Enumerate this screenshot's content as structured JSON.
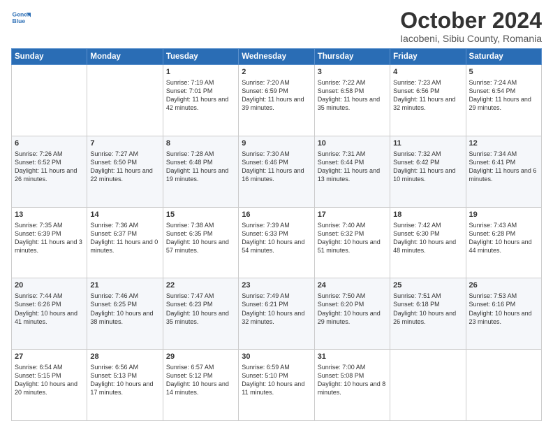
{
  "header": {
    "logo_line1": "General",
    "logo_line2": "Blue",
    "month": "October 2024",
    "location": "Iacobeni, Sibiu County, Romania"
  },
  "weekdays": [
    "Sunday",
    "Monday",
    "Tuesday",
    "Wednesday",
    "Thursday",
    "Friday",
    "Saturday"
  ],
  "weeks": [
    [
      {
        "day": "",
        "info": ""
      },
      {
        "day": "",
        "info": ""
      },
      {
        "day": "1",
        "info": "Sunrise: 7:19 AM\nSunset: 7:01 PM\nDaylight: 11 hours and 42 minutes."
      },
      {
        "day": "2",
        "info": "Sunrise: 7:20 AM\nSunset: 6:59 PM\nDaylight: 11 hours and 39 minutes."
      },
      {
        "day": "3",
        "info": "Sunrise: 7:22 AM\nSunset: 6:58 PM\nDaylight: 11 hours and 35 minutes."
      },
      {
        "day": "4",
        "info": "Sunrise: 7:23 AM\nSunset: 6:56 PM\nDaylight: 11 hours and 32 minutes."
      },
      {
        "day": "5",
        "info": "Sunrise: 7:24 AM\nSunset: 6:54 PM\nDaylight: 11 hours and 29 minutes."
      }
    ],
    [
      {
        "day": "6",
        "info": "Sunrise: 7:26 AM\nSunset: 6:52 PM\nDaylight: 11 hours and 26 minutes."
      },
      {
        "day": "7",
        "info": "Sunrise: 7:27 AM\nSunset: 6:50 PM\nDaylight: 11 hours and 22 minutes."
      },
      {
        "day": "8",
        "info": "Sunrise: 7:28 AM\nSunset: 6:48 PM\nDaylight: 11 hours and 19 minutes."
      },
      {
        "day": "9",
        "info": "Sunrise: 7:30 AM\nSunset: 6:46 PM\nDaylight: 11 hours and 16 minutes."
      },
      {
        "day": "10",
        "info": "Sunrise: 7:31 AM\nSunset: 6:44 PM\nDaylight: 11 hours and 13 minutes."
      },
      {
        "day": "11",
        "info": "Sunrise: 7:32 AM\nSunset: 6:42 PM\nDaylight: 11 hours and 10 minutes."
      },
      {
        "day": "12",
        "info": "Sunrise: 7:34 AM\nSunset: 6:41 PM\nDaylight: 11 hours and 6 minutes."
      }
    ],
    [
      {
        "day": "13",
        "info": "Sunrise: 7:35 AM\nSunset: 6:39 PM\nDaylight: 11 hours and 3 minutes."
      },
      {
        "day": "14",
        "info": "Sunrise: 7:36 AM\nSunset: 6:37 PM\nDaylight: 11 hours and 0 minutes."
      },
      {
        "day": "15",
        "info": "Sunrise: 7:38 AM\nSunset: 6:35 PM\nDaylight: 10 hours and 57 minutes."
      },
      {
        "day": "16",
        "info": "Sunrise: 7:39 AM\nSunset: 6:33 PM\nDaylight: 10 hours and 54 minutes."
      },
      {
        "day": "17",
        "info": "Sunrise: 7:40 AM\nSunset: 6:32 PM\nDaylight: 10 hours and 51 minutes."
      },
      {
        "day": "18",
        "info": "Sunrise: 7:42 AM\nSunset: 6:30 PM\nDaylight: 10 hours and 48 minutes."
      },
      {
        "day": "19",
        "info": "Sunrise: 7:43 AM\nSunset: 6:28 PM\nDaylight: 10 hours and 44 minutes."
      }
    ],
    [
      {
        "day": "20",
        "info": "Sunrise: 7:44 AM\nSunset: 6:26 PM\nDaylight: 10 hours and 41 minutes."
      },
      {
        "day": "21",
        "info": "Sunrise: 7:46 AM\nSunset: 6:25 PM\nDaylight: 10 hours and 38 minutes."
      },
      {
        "day": "22",
        "info": "Sunrise: 7:47 AM\nSunset: 6:23 PM\nDaylight: 10 hours and 35 minutes."
      },
      {
        "day": "23",
        "info": "Sunrise: 7:49 AM\nSunset: 6:21 PM\nDaylight: 10 hours and 32 minutes."
      },
      {
        "day": "24",
        "info": "Sunrise: 7:50 AM\nSunset: 6:20 PM\nDaylight: 10 hours and 29 minutes."
      },
      {
        "day": "25",
        "info": "Sunrise: 7:51 AM\nSunset: 6:18 PM\nDaylight: 10 hours and 26 minutes."
      },
      {
        "day": "26",
        "info": "Sunrise: 7:53 AM\nSunset: 6:16 PM\nDaylight: 10 hours and 23 minutes."
      }
    ],
    [
      {
        "day": "27",
        "info": "Sunrise: 6:54 AM\nSunset: 5:15 PM\nDaylight: 10 hours and 20 minutes."
      },
      {
        "day": "28",
        "info": "Sunrise: 6:56 AM\nSunset: 5:13 PM\nDaylight: 10 hours and 17 minutes."
      },
      {
        "day": "29",
        "info": "Sunrise: 6:57 AM\nSunset: 5:12 PM\nDaylight: 10 hours and 14 minutes."
      },
      {
        "day": "30",
        "info": "Sunrise: 6:59 AM\nSunset: 5:10 PM\nDaylight: 10 hours and 11 minutes."
      },
      {
        "day": "31",
        "info": "Sunrise: 7:00 AM\nSunset: 5:08 PM\nDaylight: 10 hours and 8 minutes."
      },
      {
        "day": "",
        "info": ""
      },
      {
        "day": "",
        "info": ""
      }
    ]
  ]
}
